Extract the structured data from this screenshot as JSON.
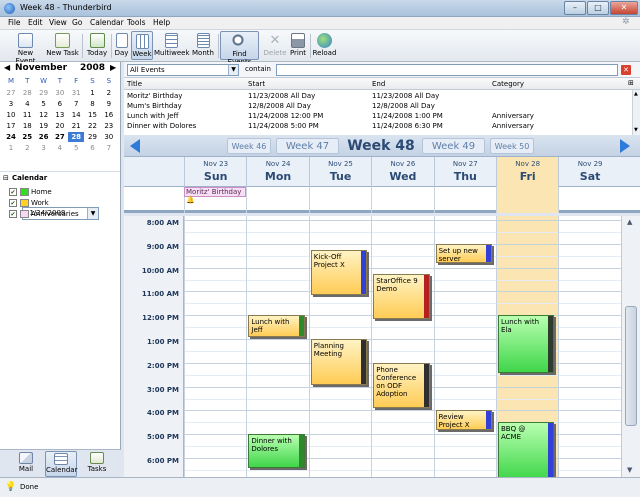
{
  "window": {
    "title": "Week 48 - Thunderbird",
    "min": "–",
    "max": "□",
    "close": "✕"
  },
  "menu": [
    "File",
    "Edit",
    "View",
    "Go",
    "Calendar",
    "Tools",
    "Help"
  ],
  "toolbar": [
    {
      "label": "New Event",
      "icon": "new-event-icon"
    },
    {
      "label": "New Task",
      "icon": "new-task-icon"
    },
    {
      "label": "Today",
      "icon": "today-icon"
    },
    {
      "label": "Day",
      "icon": "day-view-icon"
    },
    {
      "label": "Week",
      "icon": "week-view-icon"
    },
    {
      "label": "Multiweek",
      "icon": "multiweek-view-icon"
    },
    {
      "label": "Month",
      "icon": "month-view-icon"
    },
    {
      "label": "Find Events",
      "icon": "find-events-icon"
    },
    {
      "label": "Delete",
      "icon": "delete-icon"
    },
    {
      "label": "Print",
      "icon": "print-icon"
    },
    {
      "label": "Reload",
      "icon": "reload-icon"
    }
  ],
  "minical": {
    "month": "November",
    "year": "2008",
    "weekdays": [
      "M",
      "T",
      "W",
      "T",
      "F",
      "S",
      "S"
    ],
    "rows": [
      [
        "27",
        "28",
        "29",
        "30",
        "31",
        "1",
        "2"
      ],
      [
        "3",
        "4",
        "5",
        "6",
        "7",
        "8",
        "9"
      ],
      [
        "10",
        "11",
        "12",
        "13",
        "14",
        "15",
        "16"
      ],
      [
        "17",
        "18",
        "19",
        "20",
        "21",
        "22",
        "23"
      ],
      [
        "24",
        "25",
        "26",
        "27",
        "28",
        "29",
        "30"
      ],
      [
        "1",
        "2",
        "3",
        "4",
        "5",
        "6",
        "7"
      ]
    ],
    "selected": "28",
    "date_value": "11/24/2008"
  },
  "calendars": {
    "header": "Calendar",
    "items": [
      {
        "name": "Home",
        "color": "#33dd22"
      },
      {
        "name": "Work",
        "color": "#ffd02a"
      },
      {
        "name": "Anniversaries",
        "color": "#f8d7f3"
      }
    ]
  },
  "bottom_buttons": [
    {
      "label": "Mail",
      "icon": "mail-icon"
    },
    {
      "label": "Calendar",
      "icon": "calendar-icon"
    },
    {
      "label": "Tasks",
      "icon": "tasks-icon"
    }
  ],
  "status": "Done",
  "filter": {
    "selected": "All Events",
    "contain_label": "contain",
    "search_value": ""
  },
  "event_list": {
    "columns": [
      "Title",
      "Start",
      "End",
      "Category"
    ],
    "rows": [
      [
        "Moritz' Birthday",
        "11/23/2008 All Day",
        "11/23/2008 All Day",
        ""
      ],
      [
        "Mum's Birthday",
        "12/8/2008 All Day",
        "12/8/2008 All Day",
        ""
      ],
      [
        "Lunch with Jeff",
        "11/24/2008 12:00 PM",
        "11/24/2008 1:00 PM",
        "Anniversary"
      ],
      [
        "Dinner with Dolores",
        "11/24/2008 5:00 PM",
        "11/24/2008 6:30 PM",
        "Anniversary"
      ]
    ]
  },
  "weeknav": {
    "weeks": [
      "Week 46",
      "Week 47",
      "Week 48",
      "Week 49",
      "Week 50"
    ],
    "current": "Week 48"
  },
  "days": [
    {
      "date": "Nov 23",
      "name": "Sun"
    },
    {
      "date": "Nov 24",
      "name": "Mon"
    },
    {
      "date": "Nov 25",
      "name": "Tue"
    },
    {
      "date": "Nov 26",
      "name": "Wed"
    },
    {
      "date": "Nov 27",
      "name": "Thu"
    },
    {
      "date": "Nov 28",
      "name": "Fri"
    },
    {
      "date": "Nov 29",
      "name": "Sat"
    }
  ],
  "allday_event": "Moritz' Birthday",
  "times": [
    "8:00 AM",
    "9:00 AM",
    "10:00 AM",
    "11:00 AM",
    "12:00 PM",
    "1:00 PM",
    "2:00 PM",
    "3:00 PM",
    "4:00 PM",
    "5:00 PM",
    "6:00 PM"
  ],
  "events": [
    {
      "title": "Kick-Off Project X",
      "day": 2,
      "start": 9.25,
      "end": 11.25,
      "cal": "work",
      "bar": "#3340d8"
    },
    {
      "title": "Set up new server",
      "day": 4,
      "start": 9.0,
      "end": 9.9,
      "cal": "work",
      "bar": "#3340d8"
    },
    {
      "title": "StarOffice 9 Demo",
      "day": 3,
      "start": 10.25,
      "end": 12.25,
      "cal": "work",
      "bar": "#b41f1f"
    },
    {
      "title": "Lunch with Jeff",
      "day": 1,
      "start": 12.0,
      "end": 13.0,
      "cal": "work",
      "bar": "#2c8a2c"
    },
    {
      "title": "Lunch with Ela",
      "day": 5,
      "start": 12.0,
      "end": 14.5,
      "cal": "home",
      "bar": "#2f3b2f"
    },
    {
      "title": "Planning Meeting",
      "day": 2,
      "start": 13.0,
      "end": 15.0,
      "cal": "work",
      "bar": "#2f2f2f"
    },
    {
      "title": "Phone Conference on ODF Adoption",
      "day": 3,
      "start": 14.0,
      "end": 16.0,
      "cal": "work",
      "bar": "#2f2f2f"
    },
    {
      "title": "Review Project X",
      "day": 4,
      "start": 16.0,
      "end": 16.9,
      "cal": "work",
      "bar": "#3340d8"
    },
    {
      "title": "BBQ @ ACME",
      "day": 5,
      "start": 16.5,
      "end": 19.0,
      "cal": "home",
      "bar": "#3340d8"
    },
    {
      "title": "Dinner with Dolores",
      "day": 1,
      "start": 17.0,
      "end": 18.5,
      "cal": "home",
      "bar": "#2c8a2c"
    }
  ]
}
